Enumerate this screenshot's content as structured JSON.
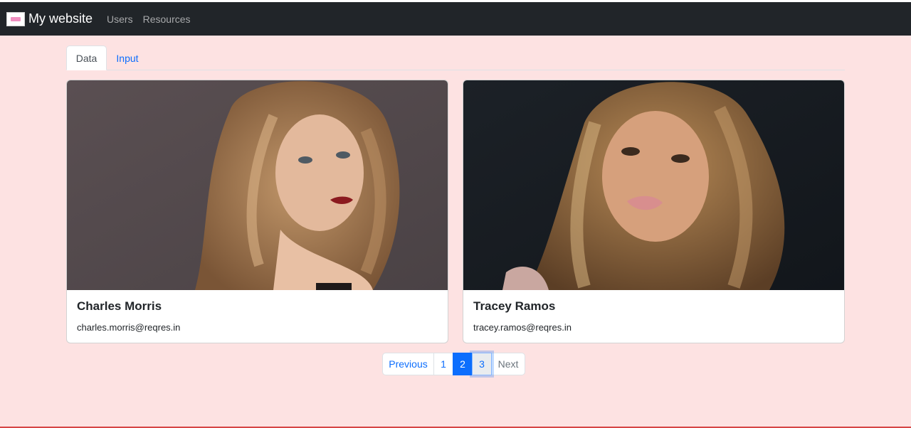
{
  "navbar": {
    "brand": "My website",
    "links": [
      "Users",
      "Resources"
    ]
  },
  "tabs": [
    {
      "label": "Data",
      "active": true
    },
    {
      "label": "Input",
      "active": false
    }
  ],
  "cards": [
    {
      "name": "Charles Morris",
      "email": "charles.morris@reqres.in",
      "image": "portrait-photo"
    },
    {
      "name": "Tracey Ramos",
      "email": "tracey.ramos@reqres.in",
      "image": "portrait-photo"
    }
  ],
  "pagination": {
    "previous": "Previous",
    "pages": [
      "1",
      "2",
      "3"
    ],
    "active_page": "2",
    "next": "Next"
  },
  "colors": {
    "page_background": "#fde2e2",
    "navbar": "#212529",
    "accent": "#0d6efd"
  }
}
